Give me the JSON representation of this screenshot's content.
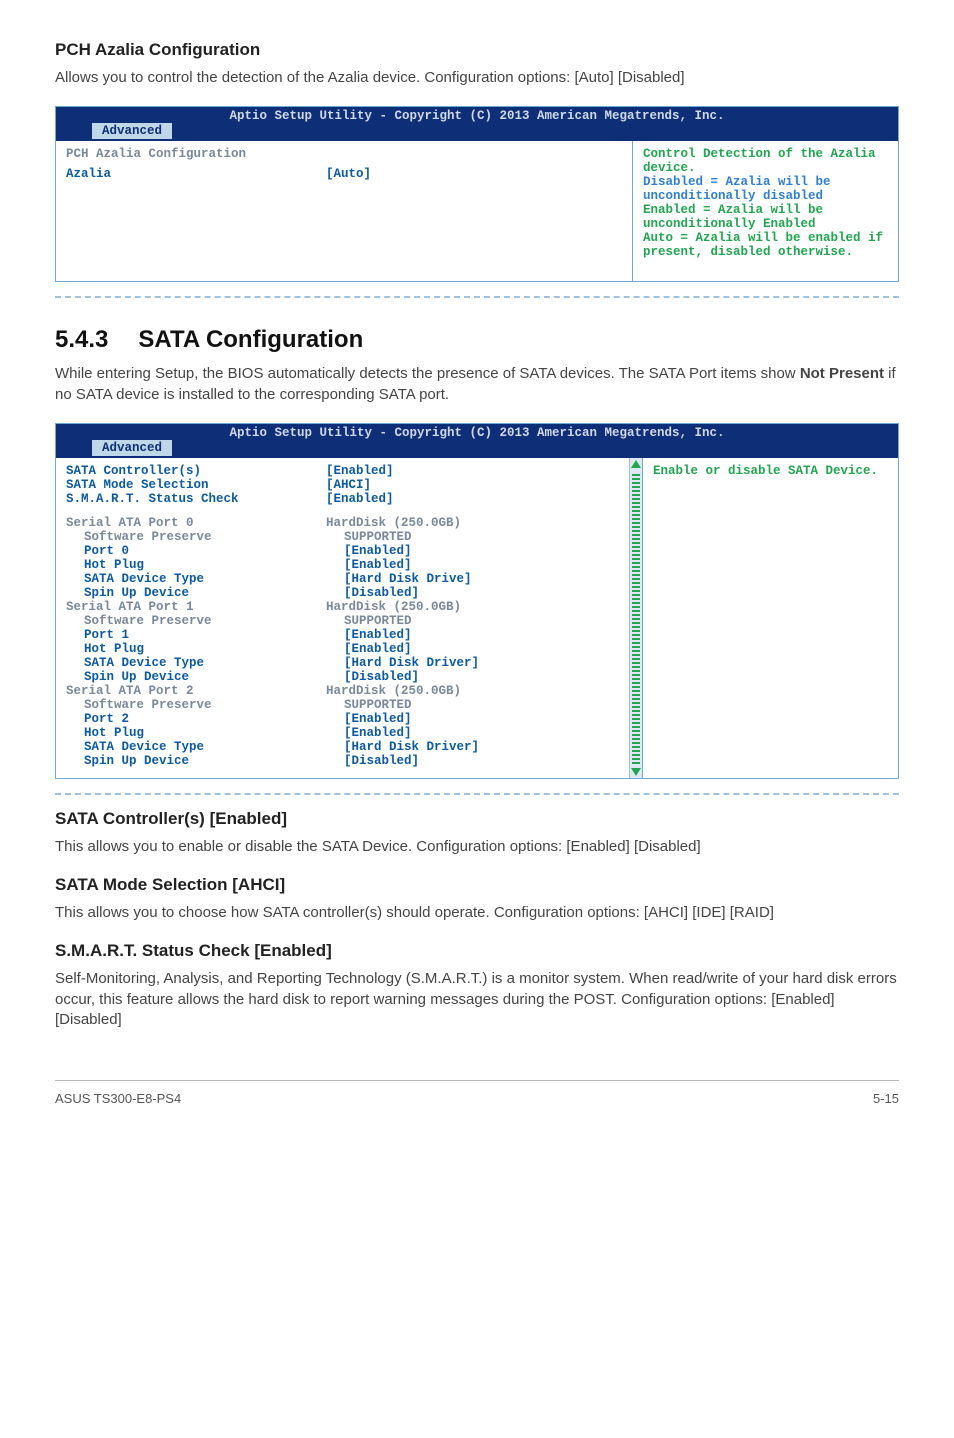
{
  "pch": {
    "heading": "PCH Azalia Configuration",
    "desc": "Allows you to control the detection of the Azalia device. Configuration options: [Auto] [Disabled]",
    "bios": {
      "title": "Aptio Setup Utility - Copyright (C) 2013 American Megatrends, Inc.",
      "tab": "Advanced",
      "row_label": "PCH Azalia Configuration",
      "field_label": "Azalia",
      "field_value": "[Auto]",
      "help1": "Control Detection of the Azalia device.",
      "help2": "Disabled = Azalia will be unconditionally disabled",
      "help3": "Enabled = Azalia will be unconditionally Enabled",
      "help4": "Auto = Azalia will be enabled if present, disabled otherwise."
    }
  },
  "section": {
    "num": "5.4.3",
    "title": "SATA Configuration",
    "intro_pre": "While entering Setup, the BIOS automatically detects the presence of SATA devices. The SATA Port items show ",
    "intro_bold": "Not Present",
    "intro_post": " if no SATA device is installed to the corresponding SATA port."
  },
  "sata_bios": {
    "title": "Aptio Setup Utility - Copyright (C) 2013 American Megatrends, Inc.",
    "tab": "Advanced",
    "help": "Enable or disable SATA Device.",
    "rows": {
      "ctrl_l": "SATA Controller(s)",
      "ctrl_v": "[Enabled]",
      "mode_l": "SATA Mode Selection",
      "mode_v": "[AHCI]",
      "smart_l": "S.M.A.R.T. Status Check",
      "smart_v": "[Enabled]",
      "p0_l": "Serial ATA Port 0",
      "p0_v": "HardDisk  (250.0GB)",
      "p0a_l": "Software Preserve",
      "p0a_v": "SUPPORTED",
      "p0b_l": "Port 0",
      "p0b_v": "[Enabled]",
      "p0c_l": "Hot Plug",
      "p0c_v": "[Enabled]",
      "p0d_l": "SATA Device Type",
      "p0d_v": "[Hard Disk Drive]",
      "p0e_l": "Spin Up Device",
      "p0e_v": "[Disabled]",
      "p1_l": "Serial ATA Port 1",
      "p1_v": "HardDisk  (250.0GB)",
      "p1a_l": "Software Preserve",
      "p1a_v": "SUPPORTED",
      "p1b_l": "Port 1",
      "p1b_v": "[Enabled]",
      "p1c_l": "Hot Plug",
      "p1c_v": "[Enabled]",
      "p1d_l": "SATA Device Type",
      "p1d_v": "[Hard Disk Driver]",
      "p1e_l": "Spin Up Device",
      "p1e_v": "[Disabled]",
      "p2_l": "Serial ATA Port 2",
      "p2_v": "HardDisk  (250.0GB)",
      "p2a_l": "Software Preserve",
      "p2a_v": "SUPPORTED",
      "p2b_l": "Port 2",
      "p2b_v": "[Enabled]",
      "p2c_l": "Hot Plug",
      "p2c_v": "[Enabled]",
      "p2d_l": "SATA Device Type",
      "p2d_v": "[Hard Disk Driver]",
      "p2e_l": "Spin Up Device",
      "p2e_v": "[Disabled]"
    }
  },
  "opts": {
    "sc": {
      "h": "SATA Controller(s) [Enabled]",
      "t": "This allows you to enable or disable the SATA Device. Configuration options: [Enabled] [Disabled]"
    },
    "ms": {
      "h": "SATA Mode Selection [AHCI]",
      "t": "This allows you to choose how SATA controller(s) should operate. Configuration options: [AHCI] [IDE] [RAID]"
    },
    "sm": {
      "h": "S.M.A.R.T. Status Check [Enabled]",
      "t": "Self-Monitoring, Analysis, and Reporting Technology (S.M.A.R.T.) is a monitor system. When read/write of your hard disk errors occur, this feature allows the hard disk to report warning messages during the POST. Configuration options: [Enabled] [Disabled]"
    }
  },
  "footer": {
    "left": "ASUS TS300-E8-PS4",
    "right": "5-15"
  }
}
